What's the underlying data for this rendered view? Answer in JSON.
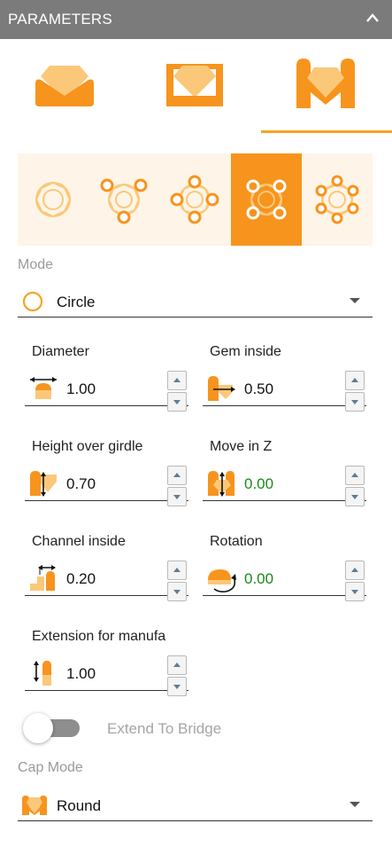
{
  "header": {
    "title": "PARAMETERS",
    "collapse_icon": "chevron-up-icon"
  },
  "mode_tabs": [
    {
      "name": "ring-seat",
      "icon": "gem-in-cradle-icon",
      "selected": false
    },
    {
      "name": "box-seat",
      "icon": "gem-in-box-icon",
      "selected": false
    },
    {
      "name": "prong-seat",
      "icon": "gem-in-prongs-icon",
      "selected": true
    }
  ],
  "setting_options": [
    {
      "name": "no-prongs",
      "prongs": 0,
      "selected": false
    },
    {
      "name": "three-prongs",
      "prongs": 3,
      "selected": false
    },
    {
      "name": "four-prongs-cross",
      "prongs": 4,
      "selected": false
    },
    {
      "name": "four-prongs-square",
      "prongs": 4,
      "selected": true
    },
    {
      "name": "six-prongs",
      "prongs": 6,
      "selected": false
    }
  ],
  "mode": {
    "label": "Mode",
    "value": "Circle",
    "icon": "circle-icon"
  },
  "fields": {
    "diameter": {
      "label": "Diameter",
      "value": "1.00",
      "icon": "diameter-icon"
    },
    "gem_inside": {
      "label": "Gem inside",
      "value": "0.50",
      "icon": "gem-inside-icon"
    },
    "height_over_girdle": {
      "label": "Height over girdle",
      "value": "0.70",
      "icon": "height-over-girdle-icon"
    },
    "move_in_z": {
      "label": "Move in Z",
      "value": "0.00",
      "icon": "move-z-icon"
    },
    "channel_inside": {
      "label": "Channel inside",
      "value": "0.20",
      "icon": "channel-inside-icon"
    },
    "rotation": {
      "label": "Rotation",
      "value": "0.00",
      "icon": "rotation-icon"
    },
    "extension": {
      "label": "Extension for manufa",
      "value": "1.00",
      "icon": "extension-icon"
    }
  },
  "extend_to_bridge": {
    "label": "Extend To Bridge",
    "enabled": false
  },
  "cap_mode": {
    "label": "Cap Mode",
    "value": "Round",
    "icon": "cap-round-icon"
  },
  "colors": {
    "accent": "#f7941d",
    "accent_light": "#fdd9a0",
    "header": "#7b7b7b",
    "value_green": "#1a8a1a"
  }
}
